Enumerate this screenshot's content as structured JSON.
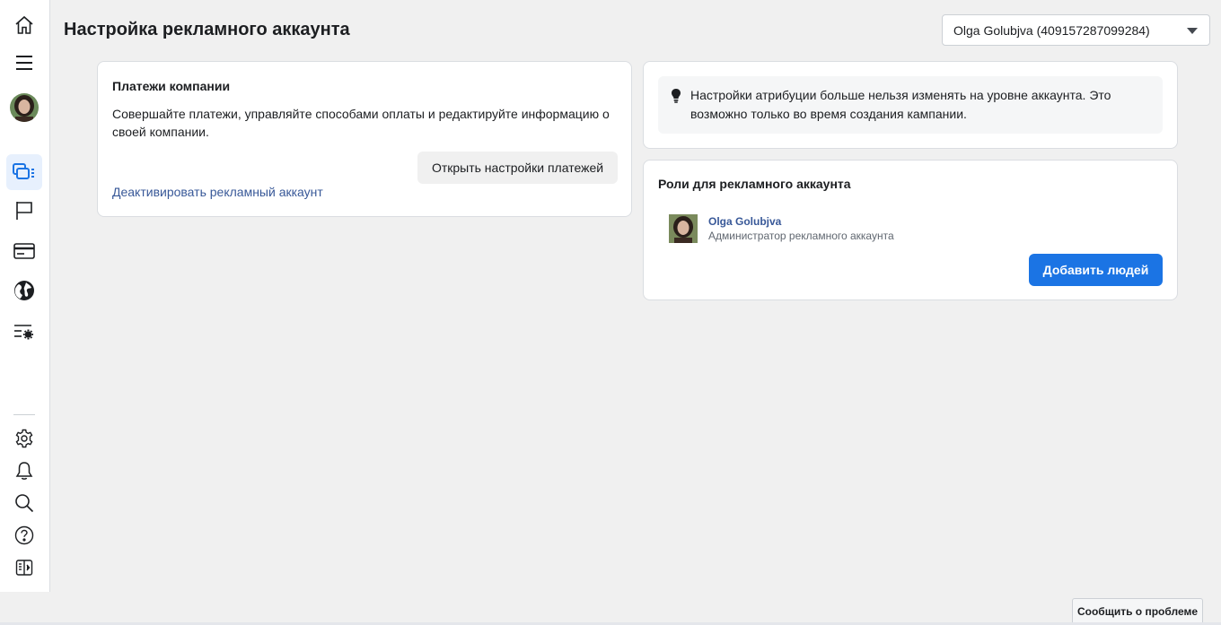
{
  "header": {
    "title": "Настройка рекламного аккаунта",
    "account_selector": "Olga Golubjva (409157287099284)"
  },
  "sidebar": {
    "items": [
      {
        "name": "home",
        "icon": "home-icon"
      },
      {
        "name": "menu",
        "icon": "hamburger-menu-icon"
      },
      {
        "name": "profile",
        "icon": "avatar"
      },
      {
        "name": "ads-manager",
        "icon": "ads-manager-icon",
        "active": true
      },
      {
        "name": "pages",
        "icon": "flag-icon"
      },
      {
        "name": "billing",
        "icon": "credit-card-icon"
      },
      {
        "name": "globe",
        "icon": "globe-icon"
      },
      {
        "name": "settings-list",
        "icon": "list-settings-icon"
      },
      {
        "name": "settings",
        "icon": "gear-icon"
      },
      {
        "name": "notifications",
        "icon": "bell-icon"
      },
      {
        "name": "search",
        "icon": "search-icon"
      },
      {
        "name": "help",
        "icon": "help-icon"
      },
      {
        "name": "collapse",
        "icon": "collapse-panel-icon"
      }
    ]
  },
  "payments": {
    "title": "Платежи компании",
    "description": "Совершайте платежи, управляйте способами оплаты и редактируйте информацию о своей компании.",
    "open_button": "Открыть настройки платежей",
    "deactivate_link": "Деактивировать рекламный аккаунт"
  },
  "info": {
    "text": "Настройки атрибуции больше нельзя изменять на уровне аккаунта. Это возможно только во время создания кампании."
  },
  "roles": {
    "title": "Роли для рекламного аккаунта",
    "person_name": "Olga Golubjva",
    "person_role": "Администратор рекламного аккаунта",
    "add_button": "Добавить людей"
  },
  "footer": {
    "report_button": "Сообщить о проблеме"
  },
  "colors": {
    "accent": "#1b74e4",
    "link": "#385898",
    "background": "#f0f0f0"
  }
}
